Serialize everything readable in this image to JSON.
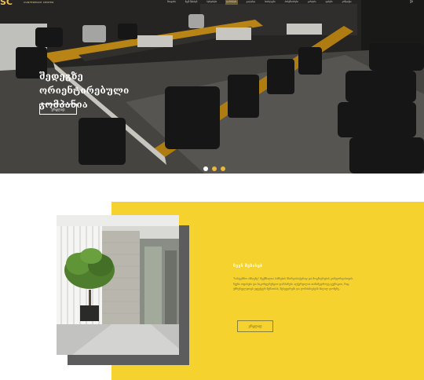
{
  "header": {
    "logo_text": "CONFERENCE CENTER",
    "nav": [
      {
        "label": "მთავარი",
        "active": false
      },
      {
        "label": "ჩვენ შესახებ",
        "active": false
      },
      {
        "label": "სერვისები",
        "active": false
      },
      {
        "label": "დარბაზები",
        "active": true
      },
      {
        "label": "გალერეა",
        "active": false
      },
      {
        "label": "სიახლეები",
        "active": false
      },
      {
        "label": "პარტნიორები",
        "active": false
      },
      {
        "label": "კარიერა",
        "active": false
      },
      {
        "label": "ფასები",
        "active": false
      },
      {
        "label": "კონტაქტი",
        "active": false
      }
    ],
    "language": "ქა"
  },
  "hero": {
    "title": "შედეგზე ორიენტირებული კომპანია",
    "button_label": "ვრცლად",
    "slides": 3,
    "active_slide": 0
  },
  "about": {
    "title": "ჩვენ შესახებ",
    "text": "\"სასტუმრო ამბიენტ\" შექმნილია ბიზნესის მხარდასაჭერად და მოგზაურების კომფორტისთვის. ჩვენი ოფისები და საკონფერენციო დარბაზები აღჭურვილია თანამედროვე ტექნიკით, რაც უზრუნველყოფს ეფექტურ მუშაობას, შეხვედრებს და ღონისძიებებს მაღალ დონეზე.",
    "button_label": "ვრცლად"
  },
  "colors": {
    "accent_yellow": "#f5d22d",
    "shadow_gray": "#5c5c5c",
    "table_orange": "#e0a21a"
  }
}
